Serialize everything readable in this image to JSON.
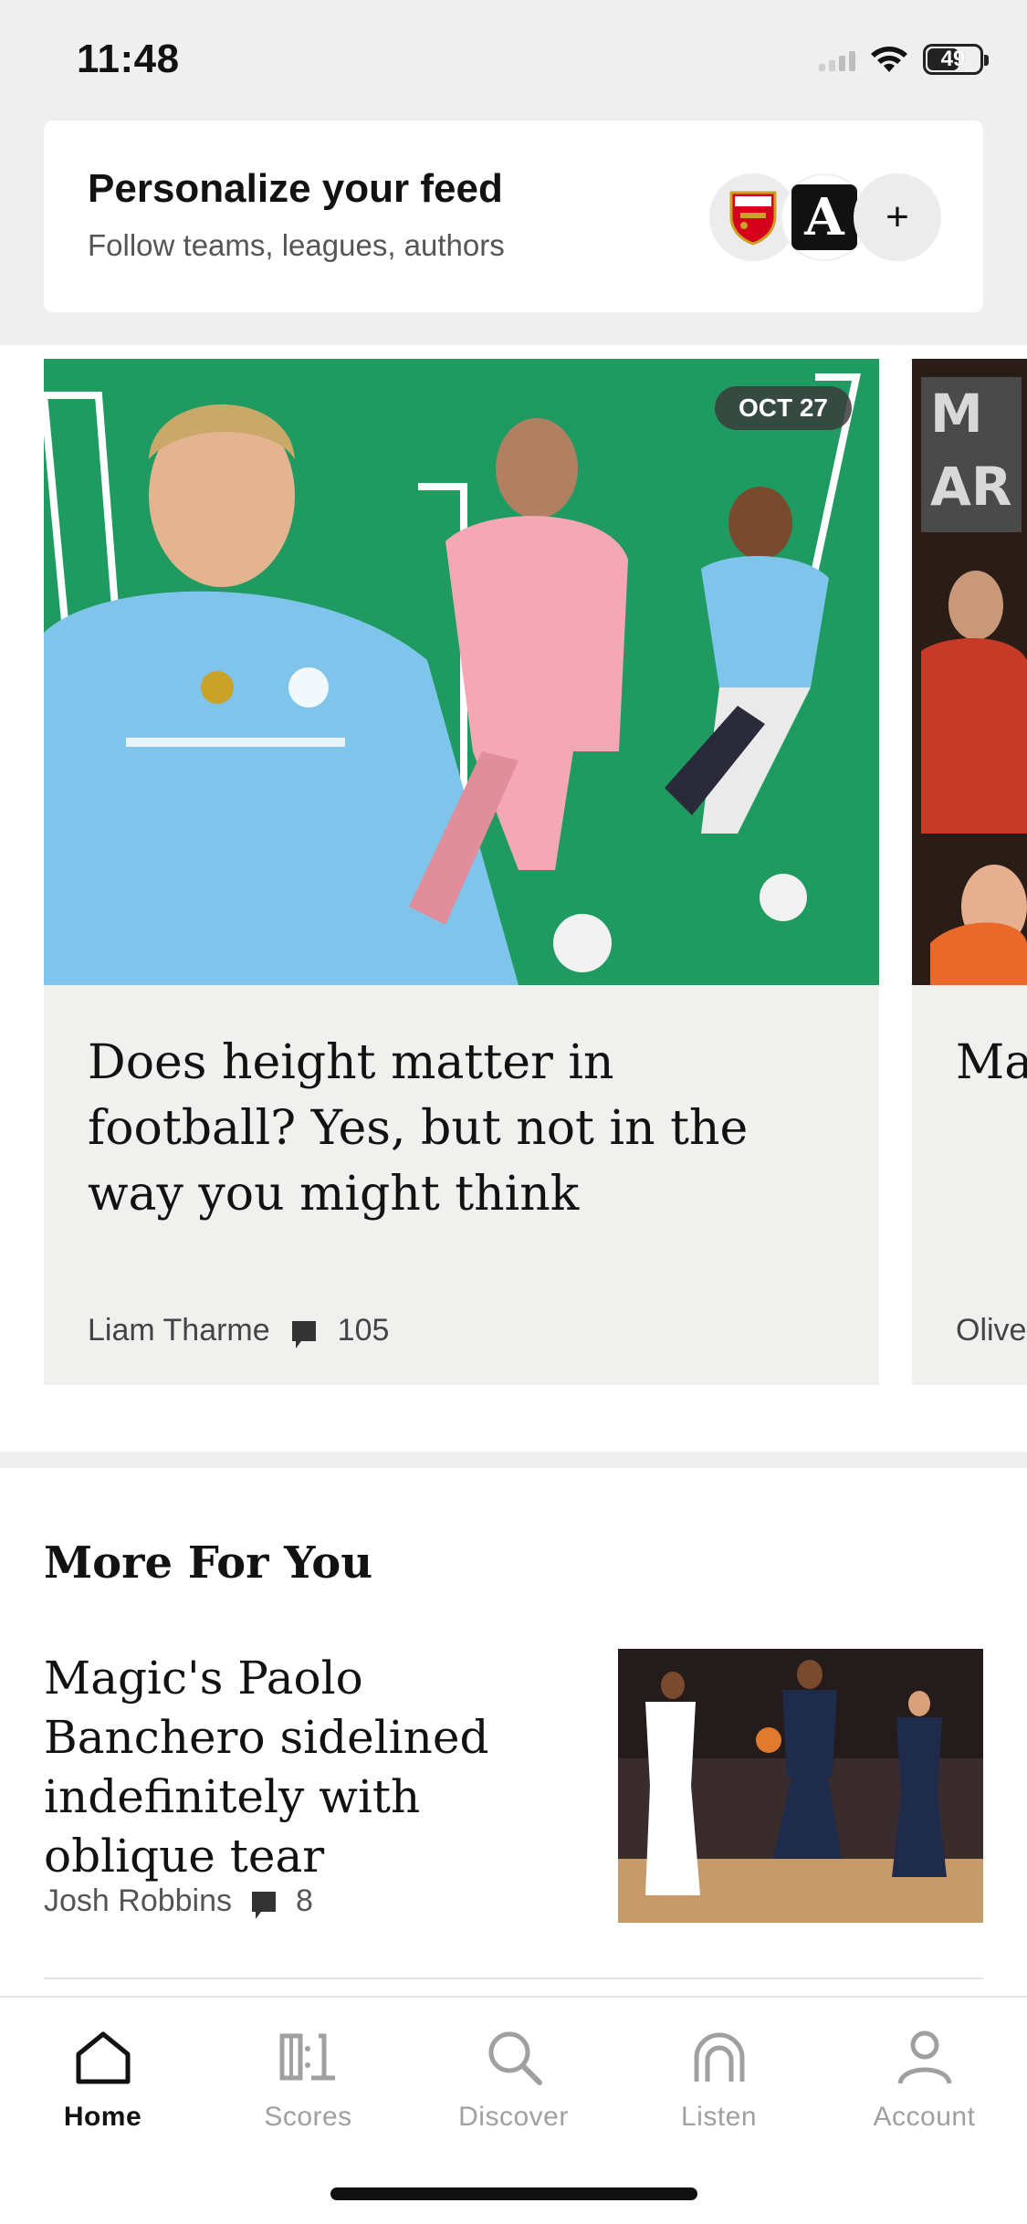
{
  "status_bar": {
    "time": "11:48",
    "battery": "49"
  },
  "personalize": {
    "title": "Personalize your feed",
    "subtitle": "Follow teams, leagues, authors",
    "avatars": [
      "arsenal-badge-icon",
      "athletic-a-logo",
      "plus-icon"
    ],
    "plus": "+",
    "a_logo": "A"
  },
  "carousel": {
    "cards": [
      {
        "date": "OCT 27",
        "headline": "Does height matter in football? Yes, but not in the way you might think",
        "author": "Liam Tharme",
        "comments": "105"
      },
      {
        "headline": "Ma the tho",
        "author": "Oliver"
      }
    ]
  },
  "more_for_you": {
    "title": "More For You",
    "stories": [
      {
        "headline": "Magic's Paolo Banchero sidelined indefinitely with oblique tear",
        "author": "Josh Robbins",
        "comments": "8"
      }
    ]
  },
  "tabbar": {
    "tabs": [
      {
        "label": "Home",
        "icon": "home-icon",
        "active": true
      },
      {
        "label": "Scores",
        "icon": "scores-icon",
        "active": false
      },
      {
        "label": "Discover",
        "icon": "search-icon",
        "active": false
      },
      {
        "label": "Listen",
        "icon": "headphones-icon",
        "active": false
      },
      {
        "label": "Account",
        "icon": "account-icon",
        "active": false
      }
    ]
  },
  "colors": {
    "accent_bg": "#efefef",
    "card_bg": "#f0f0ee",
    "pitch_green": "#1f9b61"
  }
}
